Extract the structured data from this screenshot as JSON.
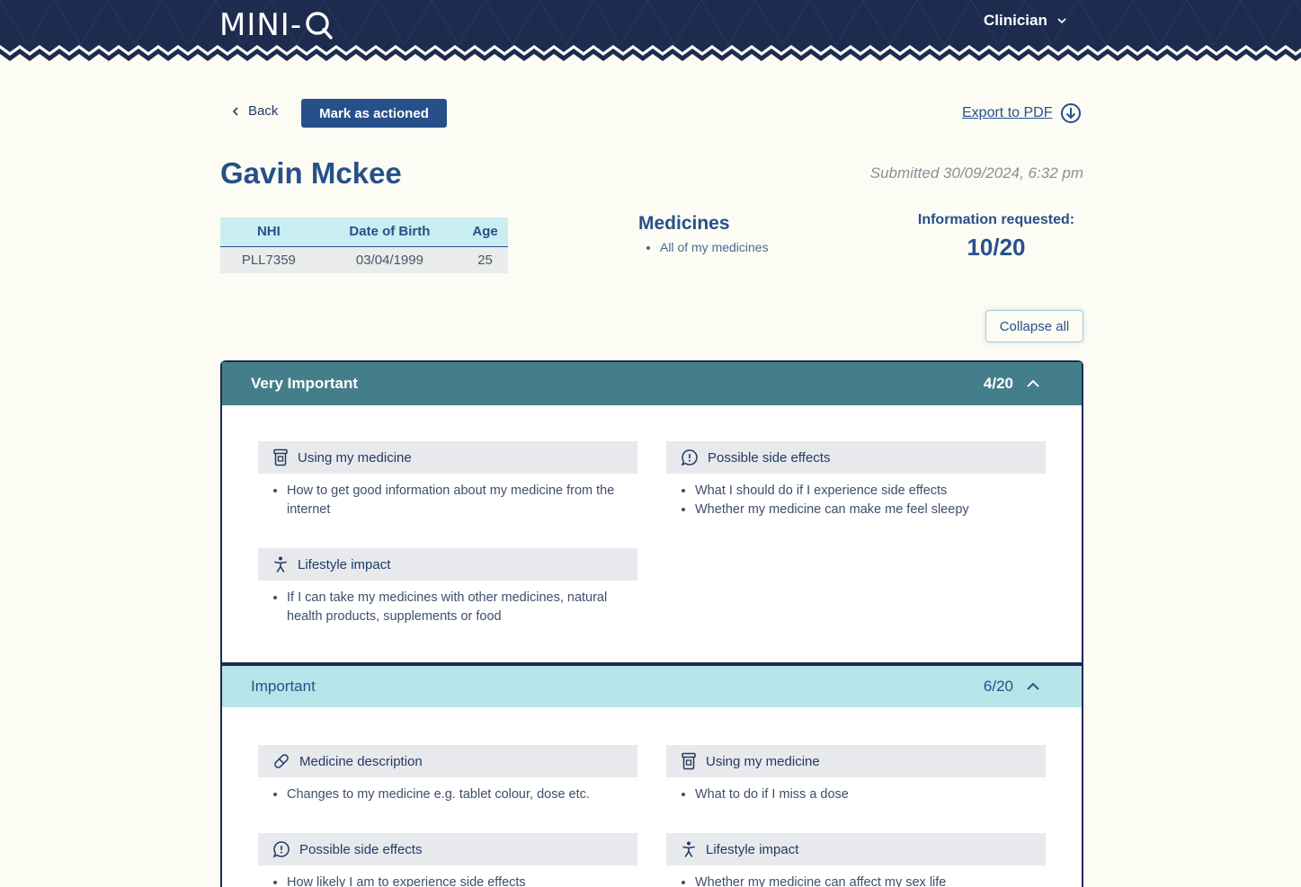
{
  "header": {
    "logo": "MINI-Q",
    "logo_prefix": "MINI-",
    "role": "Clinician"
  },
  "toolbar": {
    "back_label": "Back",
    "mark_label": "Mark as actioned",
    "export_label": "Export to PDF"
  },
  "patient": {
    "name": "Gavin Mckee",
    "submitted": "Submitted 30/09/2024, 6:32 pm",
    "table": {
      "headers": [
        "NHI",
        "Date of Birth",
        "Age"
      ],
      "row": [
        "PLL7359",
        "03/04/1999",
        "25"
      ]
    },
    "medicines_title": "Medicines",
    "medicines": [
      "All of my medicines"
    ],
    "info_label": "Information requested:",
    "info_value": "10/20"
  },
  "collapse_label": "Collapse all",
  "panels": [
    {
      "title": "Very Important",
      "count": "4/20",
      "categories": [
        {
          "icon": "pill-bottle-icon",
          "title": "Using my medicine",
          "items": [
            "How to get good information about my medicine from the internet"
          ]
        },
        {
          "icon": "speech-alert-icon",
          "title": "Possible side effects",
          "items": [
            "What I should do if I experience side effects",
            "Whether my medicine can make me feel sleepy"
          ]
        },
        {
          "icon": "person-icon",
          "title": "Lifestyle impact",
          "items": [
            "If I can take my medicines with other medicines, natural health products, supplements or food"
          ]
        }
      ]
    },
    {
      "title": "Important",
      "count": "6/20",
      "categories": [
        {
          "icon": "capsule-icon",
          "title": "Medicine description",
          "items": [
            "Changes to my medicine e.g. tablet colour, dose etc."
          ]
        },
        {
          "icon": "pill-bottle-icon",
          "title": "Using my medicine",
          "items": [
            "What to do if I miss a dose"
          ]
        },
        {
          "icon": "speech-alert-icon",
          "title": "Possible side effects",
          "items": [
            "How likely I am to experience side effects"
          ]
        },
        {
          "icon": "person-icon",
          "title": "Lifestyle impact",
          "items": [
            "Whether my medicine can affect my sex life"
          ]
        }
      ]
    }
  ],
  "colors": {
    "header_bg": "#1d2b4f",
    "primary": "#27508a",
    "very_important_bg": "#457e8b",
    "important_bg": "#b6e4e8",
    "page_bg": "#fcfcf4"
  }
}
